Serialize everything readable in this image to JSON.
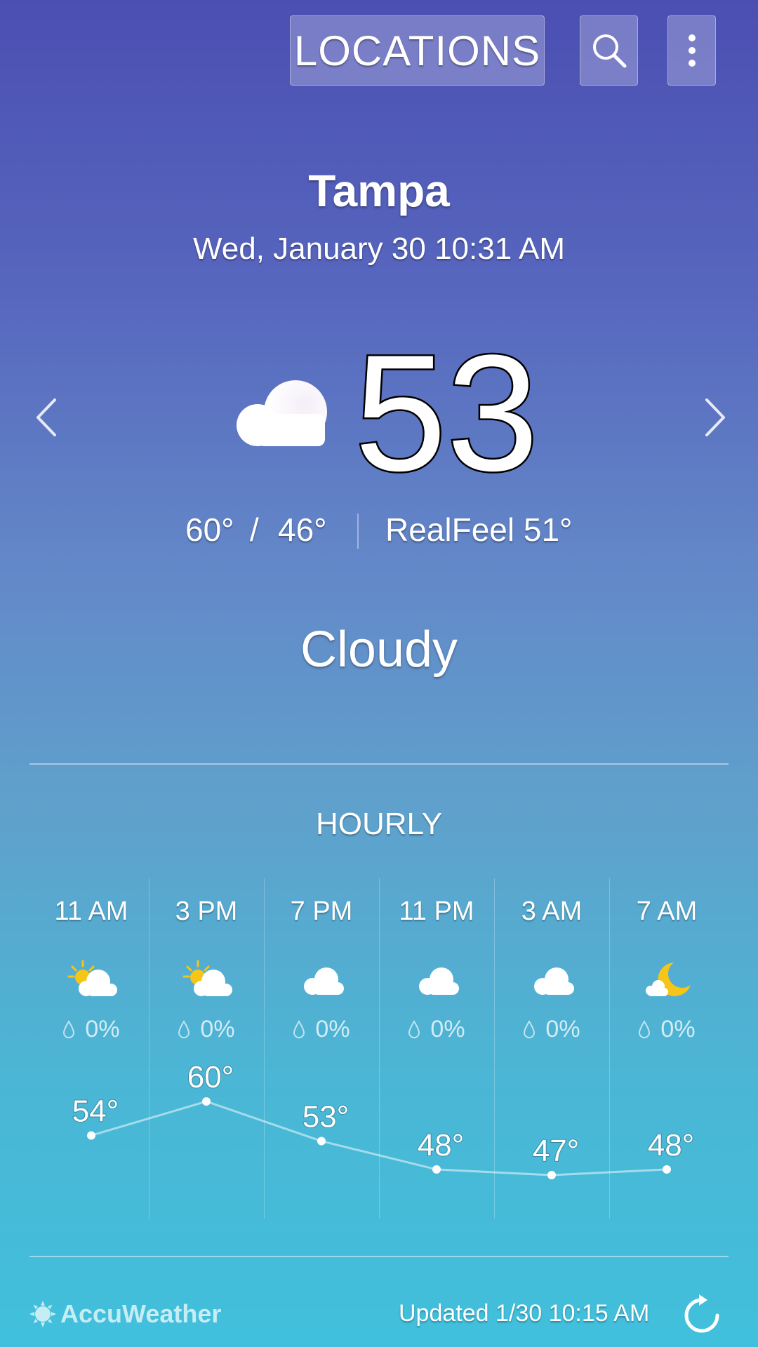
{
  "header": {
    "locations_label": "LOCATIONS",
    "search_icon": "search-icon",
    "more_icon": "more-vert-icon"
  },
  "current": {
    "city": "Tampa",
    "datetime": "Wed, January 30 10:31 AM",
    "temperature": "53°",
    "icon": "cloud-icon",
    "high": "60°",
    "separator": "/",
    "low": "46°",
    "realfeel": "RealFeel 51°",
    "condition": "Cloudy"
  },
  "hourly": {
    "title": "HOURLY",
    "items": [
      {
        "time": "11 AM",
        "icon": "partly-sunny-icon",
        "precip": "0%",
        "temp": "54°",
        "value": 54
      },
      {
        "time": "3 PM",
        "icon": "partly-sunny-icon",
        "precip": "0%",
        "temp": "60°",
        "value": 60
      },
      {
        "time": "7 PM",
        "icon": "cloud-icon",
        "precip": "0%",
        "temp": "53°",
        "value": 53
      },
      {
        "time": "11 PM",
        "icon": "cloud-icon",
        "precip": "0%",
        "temp": "48°",
        "value": 48
      },
      {
        "time": "3 AM",
        "icon": "cloud-icon",
        "precip": "0%",
        "temp": "47°",
        "value": 47
      },
      {
        "time": "7 AM",
        "icon": "moon-cloud-icon",
        "precip": "0%",
        "temp": "48°",
        "value": 48
      }
    ]
  },
  "footer": {
    "brand": "AccuWeather",
    "updated": "Updated  1/30  10:15 AM",
    "refresh_icon": "refresh-icon"
  },
  "colors": {
    "bg_top": "#4b4fb2",
    "bg_bottom": "#40c0dc",
    "sun": "#f5c518"
  }
}
